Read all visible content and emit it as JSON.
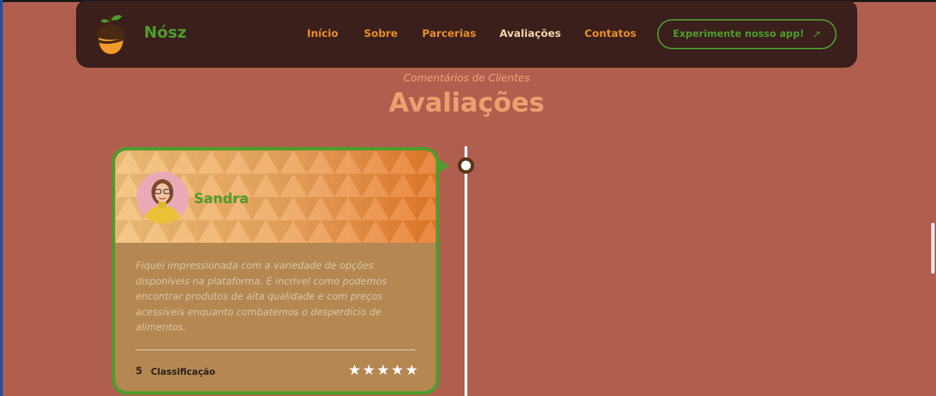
{
  "nav": {
    "brand": "Nósz",
    "links": [
      {
        "label": "Início",
        "active": false
      },
      {
        "label": "Sobre",
        "active": false
      },
      {
        "label": "Parcerias",
        "active": false
      },
      {
        "label": "Avaliações",
        "active": true
      },
      {
        "label": "Contatos",
        "active": false
      }
    ],
    "cta_label": "Experimente nosso app!",
    "cta_icon": "arrow-up-right-icon"
  },
  "section": {
    "subtitle": "Comentários de Clientes",
    "title": "Avaliações"
  },
  "review": {
    "name": "Sandra",
    "text": "Fiquei impressionada com a variedade de opções disponíveis na plataforma. É incrível como podemos encontrar produtos de alta qualidade e com preços acessíveis enquanto combatemos o desperdício de alimentos.",
    "rating": "5",
    "rating_label": "Classificação",
    "stars": 5
  },
  "colors": {
    "background": "#b05f4f",
    "navbar": "#3a1f1c",
    "accent_green": "#4e9c2d",
    "nav_orange": "#e88d24",
    "title_peach": "#ef9f6e",
    "card_body": "#b48753"
  }
}
